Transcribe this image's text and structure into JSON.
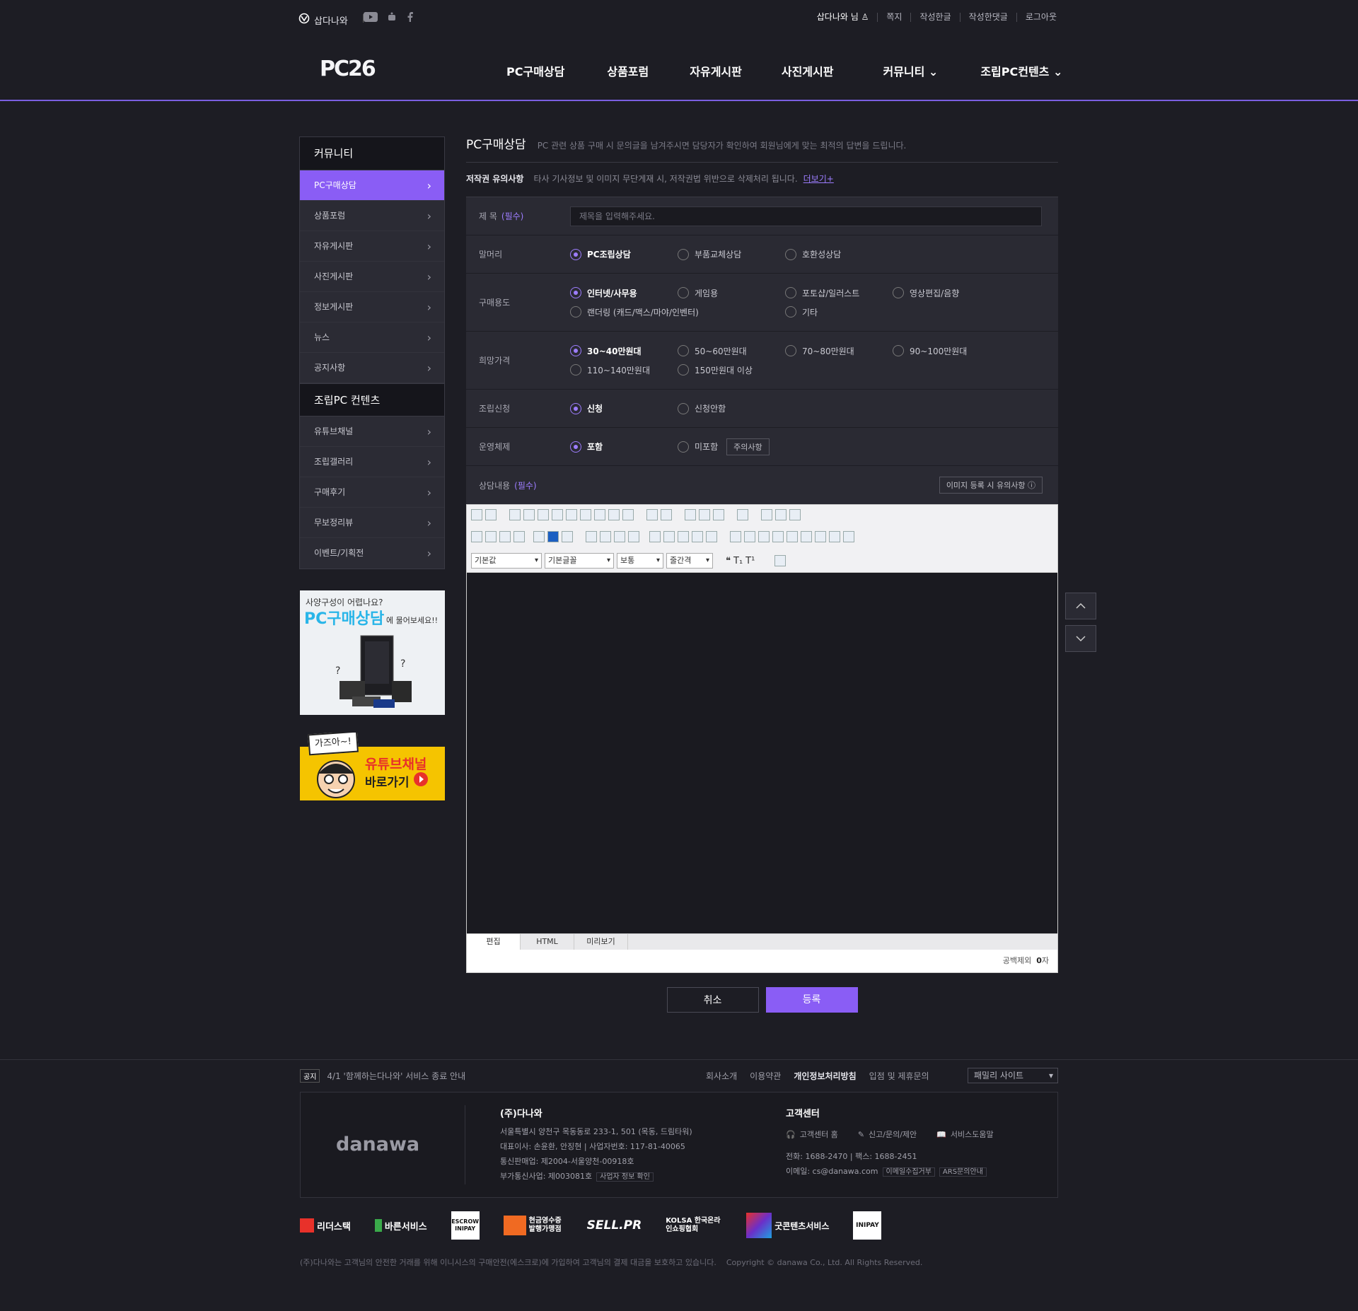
{
  "util": {
    "brand": "삽다나와",
    "user": "삽다나와 님",
    "links": [
      "쪽지",
      "작성한글",
      "작성한댓글",
      "로그아웃"
    ]
  },
  "gnb": {
    "logo": "PC26",
    "menu": [
      "PC구매상담",
      "상품포럼",
      "자유게시판",
      "사진게시판",
      "커뮤니티 ⌄",
      "조립PC컨텐츠 ⌄"
    ]
  },
  "lnb": {
    "head1": "커뮤니티",
    "items1": [
      "PC구매상담",
      "상품포럼",
      "자유게시판",
      "사진게시판",
      "정보게시판",
      "뉴스",
      "공지사항"
    ],
    "head2": "조립PC 컨텐츠",
    "items2": [
      "유튜브채널",
      "조립갤러리",
      "구매후기",
      "무보정리뷰",
      "이벤트/기획전"
    ]
  },
  "banner1": {
    "line1": "사양구성이 어렵나요?",
    "line2": "PC구매상담",
    "line3": "에 물어보세요!!"
  },
  "banner2": {
    "sign": "가즈아~!",
    "line1": "유튜브채널",
    "line2": "바로가기"
  },
  "page": {
    "title": "PC구매상담",
    "desc": "PC 관련 상품 구매 시 문의글을 남겨주시면 담당자가 확인하여 회원님에게 맞는 최적의 답변을 드립니다.",
    "copy_label": "저작권 유의사항",
    "copy_text": "타사 기사정보 및 이미지 무단게재 시, 저작권법 위반으로 삭제처리 됩니다.",
    "copy_more": "더보기+"
  },
  "form": {
    "required": "(필수)",
    "title_label": "제 목",
    "title_placeholder": "제목을 입력해주세요.",
    "head_label": "말머리",
    "head_opts": [
      "PC조립상담",
      "부품교체상담",
      "호환성상담"
    ],
    "use_label": "구매용도",
    "use_opts": [
      "인터넷/사무용",
      "게임용",
      "포토샵/일러스트",
      "영상편집/음향",
      "랜더링 (캐드/맥스/마야/인벤터)",
      "기타"
    ],
    "price_label": "희망가격",
    "price_opts": [
      "30~40만원대",
      "50~60만원대",
      "70~80만원대",
      "90~100만원대",
      "110~140만원대",
      "150만원대 이상"
    ],
    "asm_label": "조립신청",
    "asm_opts": [
      "신청",
      "신청안함"
    ],
    "os_label": "운영체제",
    "os_opts": [
      "포함",
      "미포함"
    ],
    "os_btn": "주의사항",
    "content_label": "상담내용",
    "img_btn": "이미지 등록 시 유의사항 ⓘ"
  },
  "editor": {
    "sel1": "기본값",
    "sel2": "기본글꼴",
    "sel3": "보통",
    "sel4": "줄간격",
    "tabs": [
      "편집",
      "HTML",
      "미리보기"
    ],
    "count_label": "공백제외",
    "count": "0",
    "count_unit": "자"
  },
  "buttons": {
    "cancel": "취소",
    "submit": "등록"
  },
  "footer": {
    "notice_tag": "공지",
    "notice": "4/1 '함께하는다나와' 서비스 종료 안내",
    "links": [
      "회사소개",
      "이용약관",
      "개인정보처리방침",
      "입점 및 제휴문의"
    ],
    "family": "패밀리 사이트",
    "logo": "danawa",
    "company": "(주)다나와",
    "info": [
      "서울특별시 양천구 목동동로 233-1, 501 (목동, 드림타워)",
      "대표이사: 손윤환, 안징현  |  사업자번호: 117-81-40065",
      "통신판매업: 제2004-서울양천-00918호",
      "부가통신사업: 제003081호"
    ],
    "biz_btn": "사업자 정보 확인",
    "cs_title": "고객센터",
    "cs_icons": [
      "고객센터 홈",
      "신고/문의/제안",
      "서비스도움말"
    ],
    "phone": "전화: 1688-2470  |  팩스: 1688-2451",
    "email": "이메일: cs@danawa.com",
    "email_btn": "이메일수집거부",
    "ars_btn": "ARS문의안내",
    "certs": [
      "리더스택",
      "바른서비스",
      "ESCROW INIPAY",
      "현금영수증 발행가맹점",
      "SELL.PR",
      "KOLSA 한국온라인쇼핑협회",
      "굿콘텐츠서비스",
      "INIPAY"
    ],
    "disclaimer": "(주)다나와는 고객님의 안전한 거래를 위해 이니시스의 구매안전(에스크로)에 가입하여 고객님의 결제 대금을 보호하고 있습니다.",
    "copyright": "Copyright © danawa Co., Ltd. All Rights Reserved."
  },
  "colors": {
    "accent": "#8a5df5",
    "bg": "#1d1d24"
  }
}
